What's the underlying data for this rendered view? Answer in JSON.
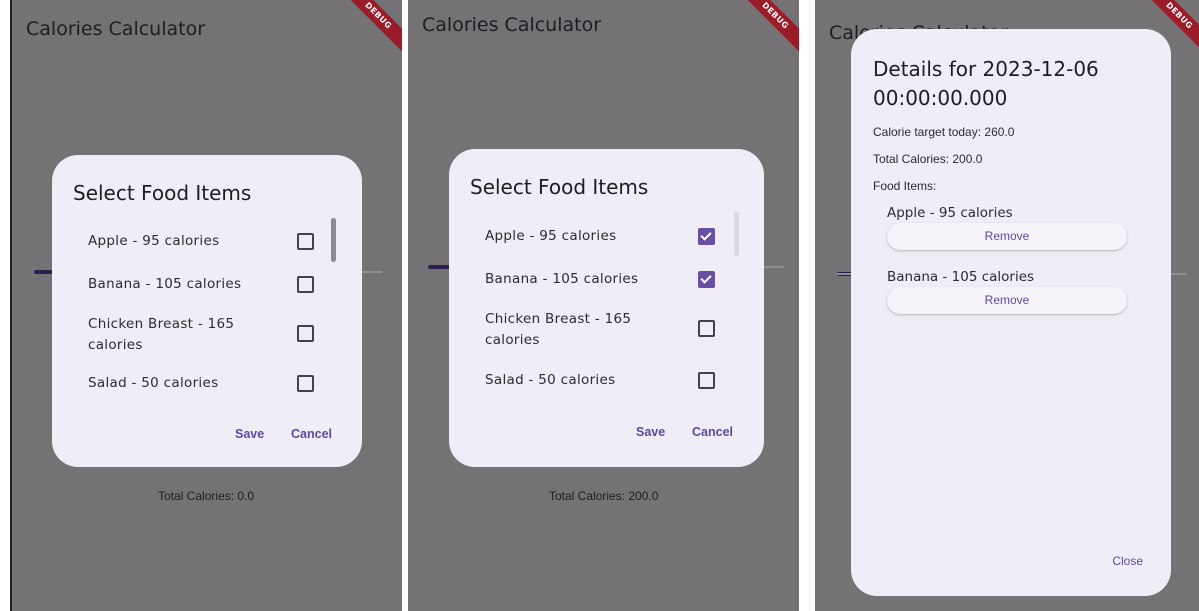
{
  "app": {
    "title": "Calories Calculator",
    "debug_label": "DEBUG"
  },
  "food_items": [
    {
      "label": "Apple - 95 calories"
    },
    {
      "label": "Banana - 105 calories"
    },
    {
      "label": "Chicken Breast - 165 calories"
    },
    {
      "label": "Salad - 50 calories"
    }
  ],
  "screens": [
    {
      "dialog_title": "Select Food Items",
      "checked": [
        false,
        false,
        false,
        false
      ],
      "save_label": "Save",
      "cancel_label": "Cancel",
      "total_text": "Total Calories: 0.0"
    },
    {
      "dialog_title": "Select Food Items",
      "checked": [
        true,
        true,
        false,
        false
      ],
      "save_label": "Save",
      "cancel_label": "Cancel",
      "total_text": "Total Calories: 200.0"
    }
  ],
  "details": {
    "title": "Details for 2023-12-06 00:00:00.000",
    "calorie_target": "Calorie target today: 260.0",
    "total_calories": "Total Calories: 200.0",
    "food_items_label": "Food Items:",
    "items": [
      {
        "label": "Apple - 95 calories",
        "remove_label": "Remove"
      },
      {
        "label": "Banana - 105 calories",
        "remove_label": "Remove"
      }
    ],
    "close_label": "Close"
  },
  "colors": {
    "accent": "#6750a4",
    "dialog_bg": "#f1edf6",
    "scrim": "#757275",
    "debug_banner": "#9a1c28"
  }
}
